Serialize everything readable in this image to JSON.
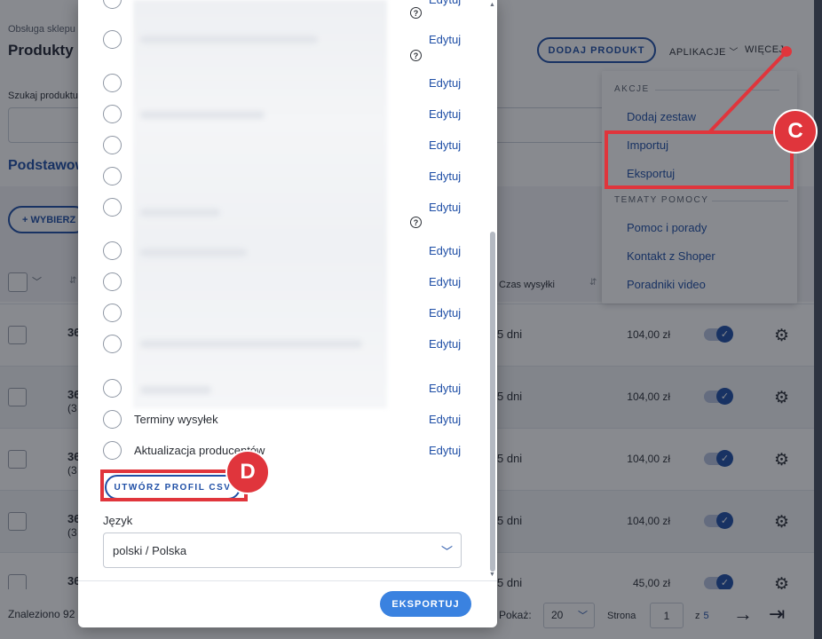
{
  "background": {
    "shop_label": "Obsługa sklepu",
    "page_title": "Produkty",
    "add_product_label": "DODAJ PRODUKT",
    "apps_label": "APLIKACJE",
    "more_label": "WIĘCEJ",
    "search_label": "Szukaj produktu",
    "tab_label": "Podstawowe",
    "choose_label": "+ WYBIERZ",
    "shipping_time_col": "Czas wysyłki",
    "rows": [
      {
        "id": "36",
        "sub": "",
        "days": "5 dni",
        "price": "104,00 zł"
      },
      {
        "id": "36",
        "sub": "(3",
        "days": "5 dni",
        "price": "104,00 zł"
      },
      {
        "id": "36",
        "sub": "(3",
        "days": "5 dni",
        "price": "104,00 zł"
      },
      {
        "id": "36",
        "sub": "(3",
        "days": "5 dni",
        "price": "104,00 zł"
      },
      {
        "id": "36",
        "sub": "",
        "days": "5 dni",
        "price": "45,00 zł"
      }
    ],
    "found_label": "Znaleziono 92",
    "per_page_label": "Pokaż:",
    "per_page_value": "20",
    "page_label": "Strona",
    "page_value": "1",
    "of_label": "z",
    "total_pages": "5"
  },
  "menu": {
    "section_actions": "AKCJE",
    "add_set": "Dodaj zestaw",
    "import": "Importuj",
    "export": "Eksportuj",
    "section_help": "TEMATY POMOCY",
    "help_tips": "Pomoc i porady",
    "contact": "Kontakt z Shoper",
    "video_guides": "Poradniki video"
  },
  "modal": {
    "edit_label": "Edytuj",
    "profiles": [
      {
        "label": "",
        "help": true
      },
      {
        "label": "",
        "help": true
      },
      {
        "label": "",
        "help": false
      },
      {
        "label": "",
        "help": false
      },
      {
        "label": "",
        "help": false
      },
      {
        "label": "",
        "help": false
      },
      {
        "label": "",
        "help": true
      },
      {
        "label": "",
        "help": false
      },
      {
        "label": "",
        "help": false
      },
      {
        "label": "",
        "help": false
      },
      {
        "label": "",
        "help": false
      },
      {
        "label": "",
        "help": false
      },
      {
        "label": "Terminy wysyłek",
        "help": false
      },
      {
        "label": "Aktualizacja producentów",
        "help": false
      }
    ],
    "create_csv_label": "UTWÓRZ PROFIL CSV",
    "language_label": "Język",
    "language_value": "polski / Polska",
    "export_button": "EKSPORTUJ"
  },
  "annotations": {
    "badge_c": "C",
    "badge_d": "D",
    "color": "#e0353c"
  }
}
